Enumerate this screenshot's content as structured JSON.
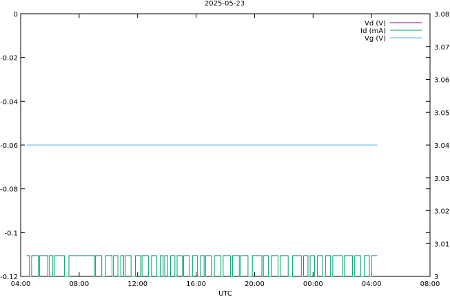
{
  "chart_data": {
    "type": "line",
    "title": "2025-05-23",
    "xlabel": "UTC",
    "x_ticks": [
      "04:00",
      "08:00",
      "12:00",
      "16:00",
      "20:00",
      "00:00",
      "04:00",
      "08:00"
    ],
    "x_range_hours": [
      4,
      32
    ],
    "y_left": {
      "ylim": [
        -0.12,
        0
      ],
      "ticks": [
        "0",
        "-0.02",
        "-0.04",
        "-0.06",
        "-0.08",
        "-0.1",
        "-0.12"
      ],
      "tick_values": [
        0,
        -0.02,
        -0.04,
        -0.06,
        -0.08,
        -0.1,
        -0.12
      ]
    },
    "y_right": {
      "ylim": [
        3,
        3.08
      ],
      "ticks": [
        "3.08",
        "3.07",
        "3.06",
        "3.05",
        "3.04",
        "3.03",
        "3.02",
        "3.01",
        "3"
      ],
      "tick_values": [
        3.08,
        3.07,
        3.06,
        3.05,
        3.04,
        3.03,
        3.02,
        3.01,
        3
      ]
    },
    "grid": false,
    "legend_position": "top-right",
    "series": [
      {
        "name": "Vd (V)",
        "color": "#8b0a8b",
        "axis": "left",
        "constant_value": -0.06,
        "x_start_hours": 4.4,
        "x_end_hours": 28.4
      },
      {
        "name": "Id (mA)",
        "color": "#009e73",
        "axis": "right",
        "high_value": 3.0063,
        "low_value": 3.0,
        "x_start_hours": 4.4,
        "x_end_hours": 28.4,
        "dips_hours": [
          [
            4.6,
            4.75
          ],
          [
            5.2,
            5.3
          ],
          [
            5.85,
            5.95
          ],
          [
            6.2,
            6.3
          ],
          [
            7.0,
            7.3
          ],
          [
            9.05,
            9.12
          ],
          [
            9.55,
            9.8
          ],
          [
            10.25,
            10.35
          ],
          [
            10.65,
            10.85
          ],
          [
            11.05,
            11.15
          ],
          [
            11.55,
            11.85
          ],
          [
            12.2,
            12.3
          ],
          [
            12.75,
            12.95
          ],
          [
            13.3,
            13.55
          ],
          [
            13.75,
            13.85
          ],
          [
            14.05,
            14.25
          ],
          [
            14.55,
            14.7
          ],
          [
            15.05,
            15.15
          ],
          [
            15.55,
            15.75
          ],
          [
            16.1,
            16.3
          ],
          [
            16.55,
            16.65
          ],
          [
            17.05,
            17.25
          ],
          [
            17.7,
            17.85
          ],
          [
            18.35,
            18.5
          ],
          [
            18.95,
            19.05
          ],
          [
            19.55,
            19.85
          ],
          [
            20.5,
            20.6
          ],
          [
            20.95,
            21.15
          ],
          [
            21.6,
            21.75
          ],
          [
            22.3,
            22.6
          ],
          [
            23.2,
            23.35
          ],
          [
            23.65,
            23.8
          ],
          [
            24.1,
            24.3
          ],
          [
            24.65,
            24.85
          ],
          [
            25.2,
            25.35
          ],
          [
            26.0,
            26.15
          ],
          [
            26.7,
            26.85
          ],
          [
            27.25,
            27.5
          ],
          [
            27.85,
            28.0
          ]
        ]
      },
      {
        "name": "Vg (V)",
        "color": "#56b4e9",
        "axis": "left",
        "constant_value": -0.06,
        "x_start_hours": 4.4,
        "x_end_hours": 28.4
      }
    ]
  }
}
